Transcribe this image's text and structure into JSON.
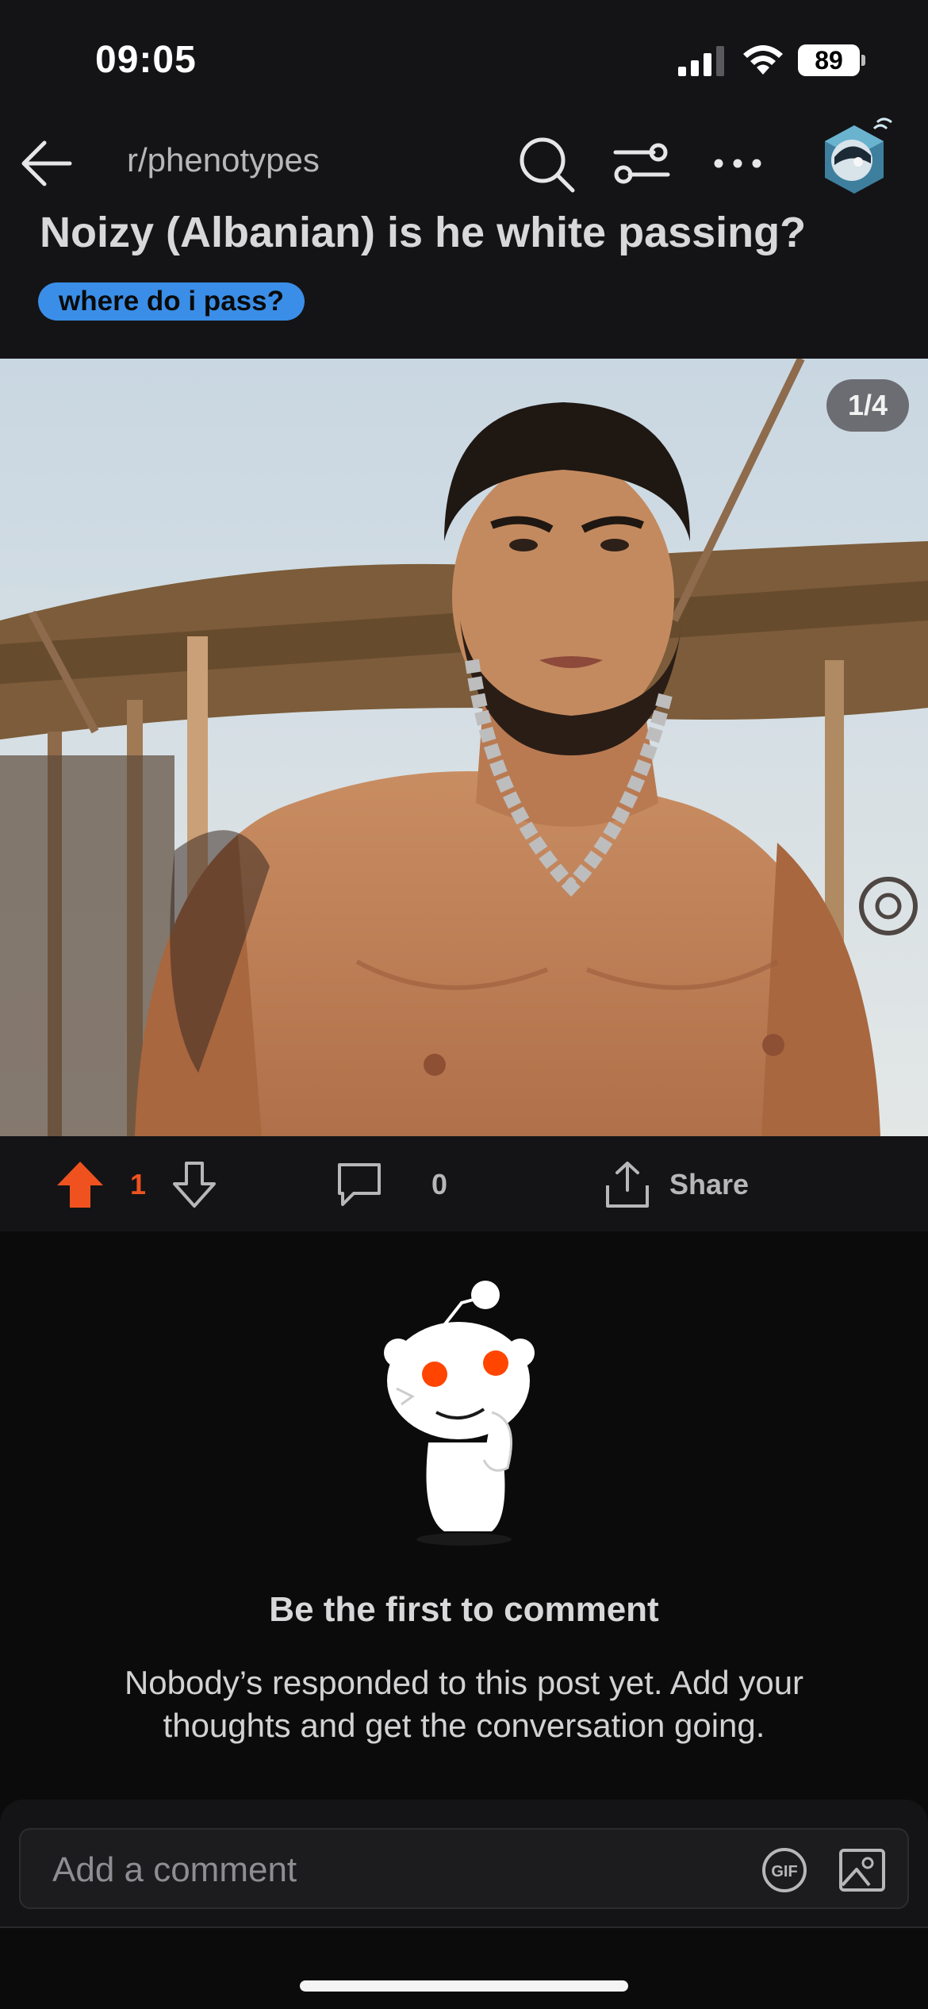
{
  "status_bar": {
    "time": "09:05",
    "battery": "89"
  },
  "nav": {
    "subreddit": "r/phenotypes",
    "icons": [
      "back-arrow-icon",
      "search-icon",
      "filter-icon",
      "more-icon",
      "avatar"
    ]
  },
  "post": {
    "title": "Noizy (Albanian) is he white passing?",
    "flair": "where do i pass?",
    "flair_color": "#3a8ee8",
    "gallery_counter": "1/4"
  },
  "actions": {
    "upvotes": "1",
    "comments": "0",
    "share_label": "Share",
    "upvote_color": "#f0521f"
  },
  "empty_state": {
    "title": "Be the first to comment",
    "text": "Nobody’s responded to this post yet. Add your thoughts and get the conversation going."
  },
  "comment_bar": {
    "placeholder": "Add a comment",
    "gif_label": "GIF"
  }
}
